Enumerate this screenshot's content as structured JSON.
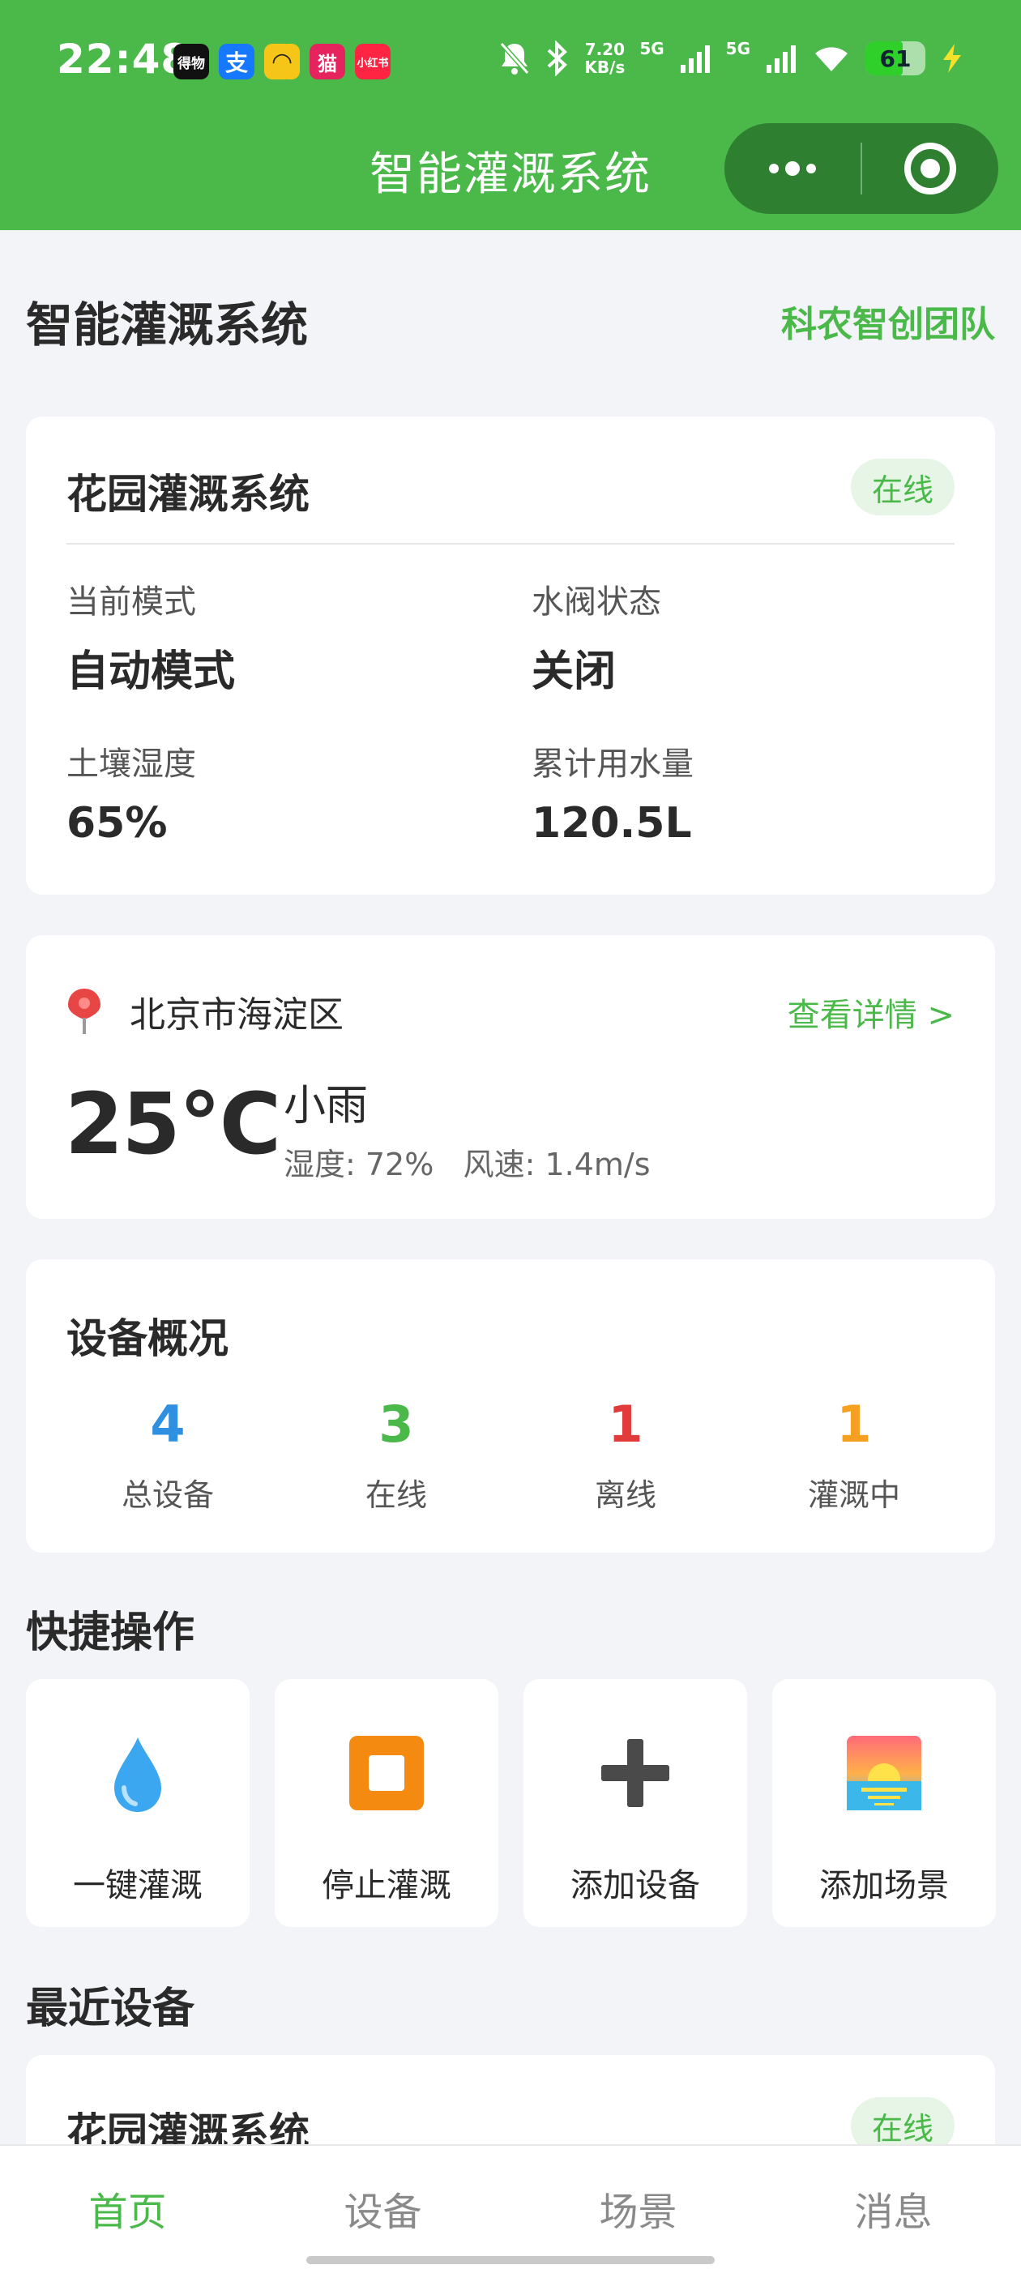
{
  "status_bar": {
    "time": "22:48",
    "notifications": [
      {
        "name": "app-notification-icon-1",
        "text": "得物",
        "color": "#111111"
      },
      {
        "name": "alipay-icon",
        "text": "支",
        "color": "#1677ff"
      },
      {
        "name": "app-notification-icon-3",
        "text": "◠",
        "color": "#f5c518"
      },
      {
        "name": "tmall-icon",
        "text": "猫",
        "color": "#e5245e"
      },
      {
        "name": "xiaohongshu-icon",
        "text": "小红书",
        "color": "#ff2442"
      }
    ],
    "speed_value": "7.20",
    "speed_unit": "KB/s",
    "network_1": "5G",
    "network_2": "5G",
    "battery": "61"
  },
  "nav": {
    "title": "智能灌溉系统"
  },
  "page": {
    "title": "智能灌溉系统",
    "team": "科农智创团队"
  },
  "system_card": {
    "name": "花园灌溉系统",
    "status": "在线",
    "metrics": [
      {
        "label": "当前模式",
        "value": "自动模式"
      },
      {
        "label": "水阀状态",
        "value": "关闭"
      },
      {
        "label": "土壤湿度",
        "value": "65%"
      },
      {
        "label": "累计用水量",
        "value": "120.5L"
      }
    ]
  },
  "weather": {
    "location": "北京市海淀区",
    "details_link": "查看详情 >",
    "temperature": "25°C",
    "condition": "小雨",
    "extra": "湿度: 72%   风速: 1.4m/s"
  },
  "devices": {
    "heading": "设备概况",
    "stats": [
      {
        "value": "4",
        "label": "总设备",
        "color": "#2f8fe0"
      },
      {
        "value": "3",
        "label": "在线",
        "color": "#4bb84a"
      },
      {
        "value": "1",
        "label": "离线",
        "color": "#e23b3b"
      },
      {
        "value": "1",
        "label": "灌溉中",
        "color": "#f5a020"
      }
    ]
  },
  "quick_actions": {
    "heading": "快捷操作",
    "items": [
      {
        "label": "一键灌溉",
        "icon": "water-drop-icon"
      },
      {
        "label": "停止灌溉",
        "icon": "stop-icon"
      },
      {
        "label": "添加设备",
        "icon": "plus-icon"
      },
      {
        "label": "添加场景",
        "icon": "sunrise-icon"
      }
    ]
  },
  "recent": {
    "heading": "最近设备",
    "device_name": "花园灌溉系统",
    "status": "在线"
  },
  "tabs": [
    {
      "label": "首页",
      "active": true
    },
    {
      "label": "设备",
      "active": false
    },
    {
      "label": "场景",
      "active": false
    },
    {
      "label": "消息",
      "active": false
    }
  ]
}
